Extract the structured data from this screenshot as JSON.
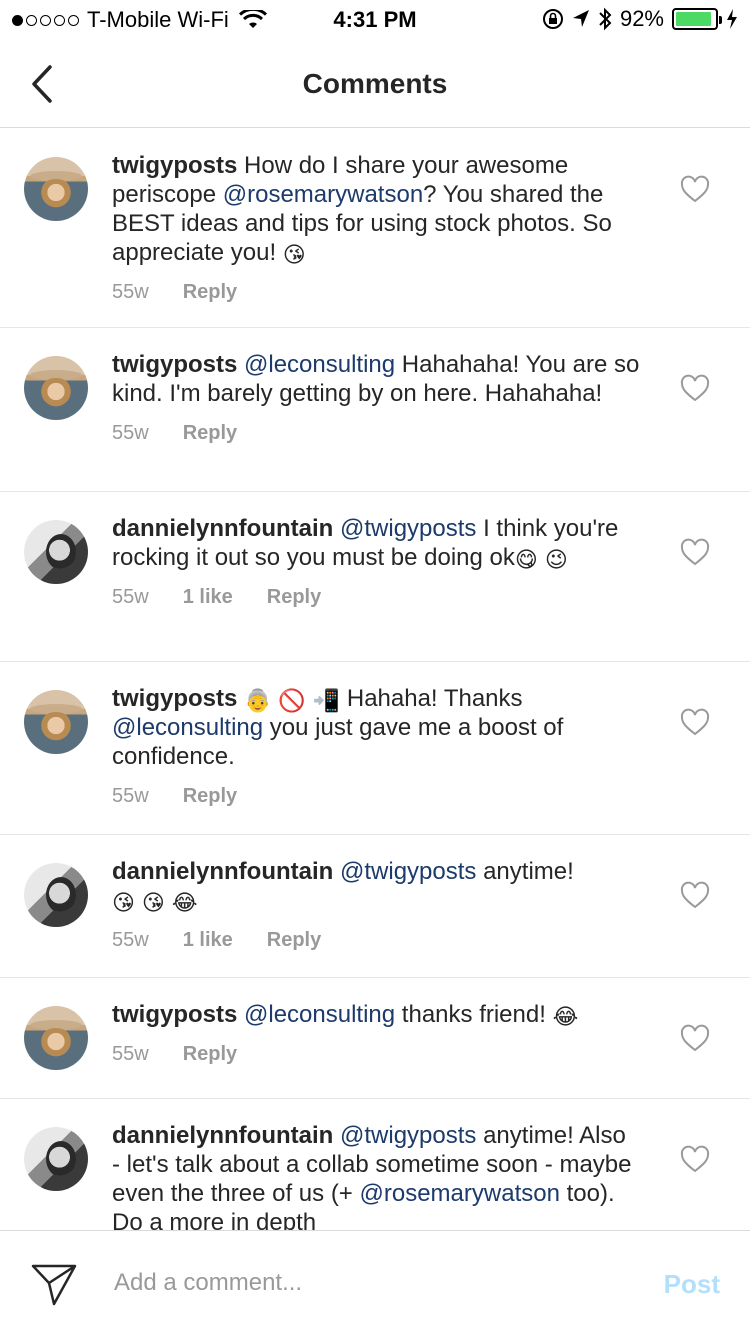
{
  "status_bar": {
    "carrier": "T-Mobile Wi-Fi",
    "time": "4:31 PM",
    "battery": "92%",
    "battery_level": 0.92,
    "icons": [
      "wifi-icon",
      "orientation-lock-icon",
      "location-icon",
      "bluetooth-icon",
      "battery-icon",
      "charging-icon"
    ]
  },
  "header": {
    "title": "Comments"
  },
  "comments": [
    {
      "username": "twigyposts",
      "pre": "How do I share your awesome periscope ",
      "mention": "@rosemarywatson",
      "post": "? You shared the BEST ideas and tips for using stock photos. So appreciate you! ",
      "emoji": "😘",
      "time": "55w",
      "likes": "",
      "reply": "Reply"
    },
    {
      "username": "twigyposts",
      "mention": "@leconsulting",
      "post": " Hahahaha! You are so kind. I'm barely getting by on here. Hahahaha!",
      "time": "55w",
      "likes": "",
      "reply": "Reply"
    },
    {
      "username": "dannielynnfountain",
      "mention": "@twigyposts",
      "post": " I think you're rocking it out so you must be doing ok",
      "emoji": "😋 😉",
      "time": "55w",
      "likes": "1 like",
      "reply": "Reply"
    },
    {
      "username": "twigyposts",
      "emoji_pre": "👵 🚫 📲",
      "post1": " Hahaha! Thanks ",
      "mention": "@leconsulting",
      "post": " you just gave me a boost of confidence.",
      "time": "55w",
      "likes": "",
      "reply": "Reply"
    },
    {
      "username": "dannielynnfountain",
      "mention": "@twigyposts",
      "post": " anytime!",
      "emoji": "😘 😘 😂",
      "time": "55w",
      "likes": "1 like",
      "reply": "Reply"
    },
    {
      "username": "twigyposts",
      "mention": "@leconsulting",
      "post": " thanks friend! ",
      "emoji": "😂",
      "time": "55w",
      "likes": "",
      "reply": "Reply"
    },
    {
      "username": "dannielynnfountain",
      "mention": "@twigyposts",
      "post": " anytime! Also - let's talk about a collab sometime soon - maybe even the three of us (+ ",
      "mention2": "@rosemarywatson",
      "post2": " too). Do a more in depth"
    }
  ],
  "composer": {
    "placeholder": "Add a comment...",
    "post_label": "Post"
  },
  "colors": {
    "mention": "#1c3a6b",
    "meta": "#999999",
    "post_disabled": "#b2dffc",
    "battery": "#4cd964"
  }
}
